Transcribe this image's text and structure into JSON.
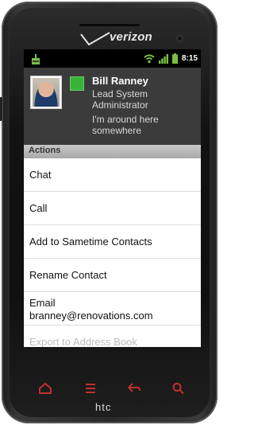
{
  "device": {
    "carrier": "verizon",
    "brand": "htc"
  },
  "statusbar": {
    "time": "8:15",
    "icons": [
      "download-icon",
      "wifi-icon",
      "signal-icon",
      "battery-icon"
    ]
  },
  "contact": {
    "name": "Bill Ranney",
    "title": "Lead System Administrator",
    "status_message": "I'm around here somewhere",
    "presence_color": "#38b23a"
  },
  "section_header": "Actions",
  "actions": [
    {
      "label": "Chat"
    },
    {
      "label": "Call"
    },
    {
      "label": "Add to Sametime Contacts"
    },
    {
      "label": "Rename Contact"
    },
    {
      "line1": "Email",
      "line2": "branney@renovations.com"
    },
    {
      "label": "Export to Address Book"
    }
  ],
  "nav_buttons": [
    "home-icon",
    "menu-icon",
    "back-icon",
    "search-icon"
  ],
  "colors": {
    "accent_red": "#c0302c",
    "header_bg": "#3b3b3b"
  }
}
